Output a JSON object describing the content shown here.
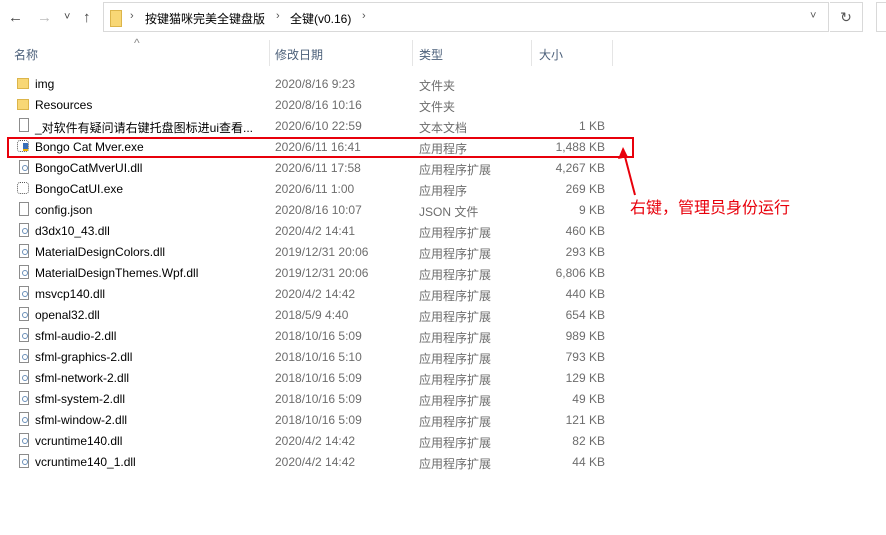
{
  "nav": {
    "back": "←",
    "forward": "→",
    "recent": "˅",
    "up": "↑",
    "refresh": "↻",
    "dropdown": "˅"
  },
  "breadcrumb": [
    "按键猫咪完美全键盘版",
    "全键(v0.16)"
  ],
  "columns": {
    "name": "名称",
    "date": "修改日期",
    "type": "类型",
    "size": "大小",
    "sort_indicator": "^"
  },
  "files": [
    {
      "name": "img",
      "date": "2020/8/16 9:23",
      "type": "文件夹",
      "size": "",
      "icon": "folder"
    },
    {
      "name": "Resources",
      "date": "2020/8/16 10:16",
      "type": "文件夹",
      "size": "",
      "icon": "folder"
    },
    {
      "name": "_对软件有疑问请右键托盘图标进ui查看...",
      "date": "2020/6/10 22:59",
      "type": "文本文档",
      "size": "1 KB",
      "icon": "doc"
    },
    {
      "name": "Bongo Cat Mver.exe",
      "date": "2020/6/11 16:41",
      "type": "应用程序",
      "size": "1,488 KB",
      "icon": "exe app"
    },
    {
      "name": "BongoCatMverUI.dll",
      "date": "2020/6/11 17:58",
      "type": "应用程序扩展",
      "size": "4,267 KB",
      "icon": "dll"
    },
    {
      "name": "BongoCatUI.exe",
      "date": "2020/6/11 1:00",
      "type": "应用程序",
      "size": "269 KB",
      "icon": "exe"
    },
    {
      "name": "config.json",
      "date": "2020/8/16 10:07",
      "type": "JSON 文件",
      "size": "9 KB",
      "icon": "json"
    },
    {
      "name": "d3dx10_43.dll",
      "date": "2020/4/2 14:41",
      "type": "应用程序扩展",
      "size": "460 KB",
      "icon": "dll"
    },
    {
      "name": "MaterialDesignColors.dll",
      "date": "2019/12/31 20:06",
      "type": "应用程序扩展",
      "size": "293 KB",
      "icon": "dll"
    },
    {
      "name": "MaterialDesignThemes.Wpf.dll",
      "date": "2019/12/31 20:06",
      "type": "应用程序扩展",
      "size": "6,806 KB",
      "icon": "dll"
    },
    {
      "name": "msvcp140.dll",
      "date": "2020/4/2 14:42",
      "type": "应用程序扩展",
      "size": "440 KB",
      "icon": "dll"
    },
    {
      "name": "openal32.dll",
      "date": "2018/5/9 4:40",
      "type": "应用程序扩展",
      "size": "654 KB",
      "icon": "dll"
    },
    {
      "name": "sfml-audio-2.dll",
      "date": "2018/10/16 5:09",
      "type": "应用程序扩展",
      "size": "989 KB",
      "icon": "dll"
    },
    {
      "name": "sfml-graphics-2.dll",
      "date": "2018/10/16 5:10",
      "type": "应用程序扩展",
      "size": "793 KB",
      "icon": "dll"
    },
    {
      "name": "sfml-network-2.dll",
      "date": "2018/10/16 5:09",
      "type": "应用程序扩展",
      "size": "129 KB",
      "icon": "dll"
    },
    {
      "name": "sfml-system-2.dll",
      "date": "2018/10/16 5:09",
      "type": "应用程序扩展",
      "size": "49 KB",
      "icon": "dll"
    },
    {
      "name": "sfml-window-2.dll",
      "date": "2018/10/16 5:09",
      "type": "应用程序扩展",
      "size": "121 KB",
      "icon": "dll"
    },
    {
      "name": "vcruntime140.dll",
      "date": "2020/4/2 14:42",
      "type": "应用程序扩展",
      "size": "82 KB",
      "icon": "dll"
    },
    {
      "name": "vcruntime140_1.dll",
      "date": "2020/4/2 14:42",
      "type": "应用程序扩展",
      "size": "44 KB",
      "icon": "dll"
    }
  ],
  "annotation": {
    "text": "右键，管理员身份运行",
    "color": "#e8000b"
  }
}
